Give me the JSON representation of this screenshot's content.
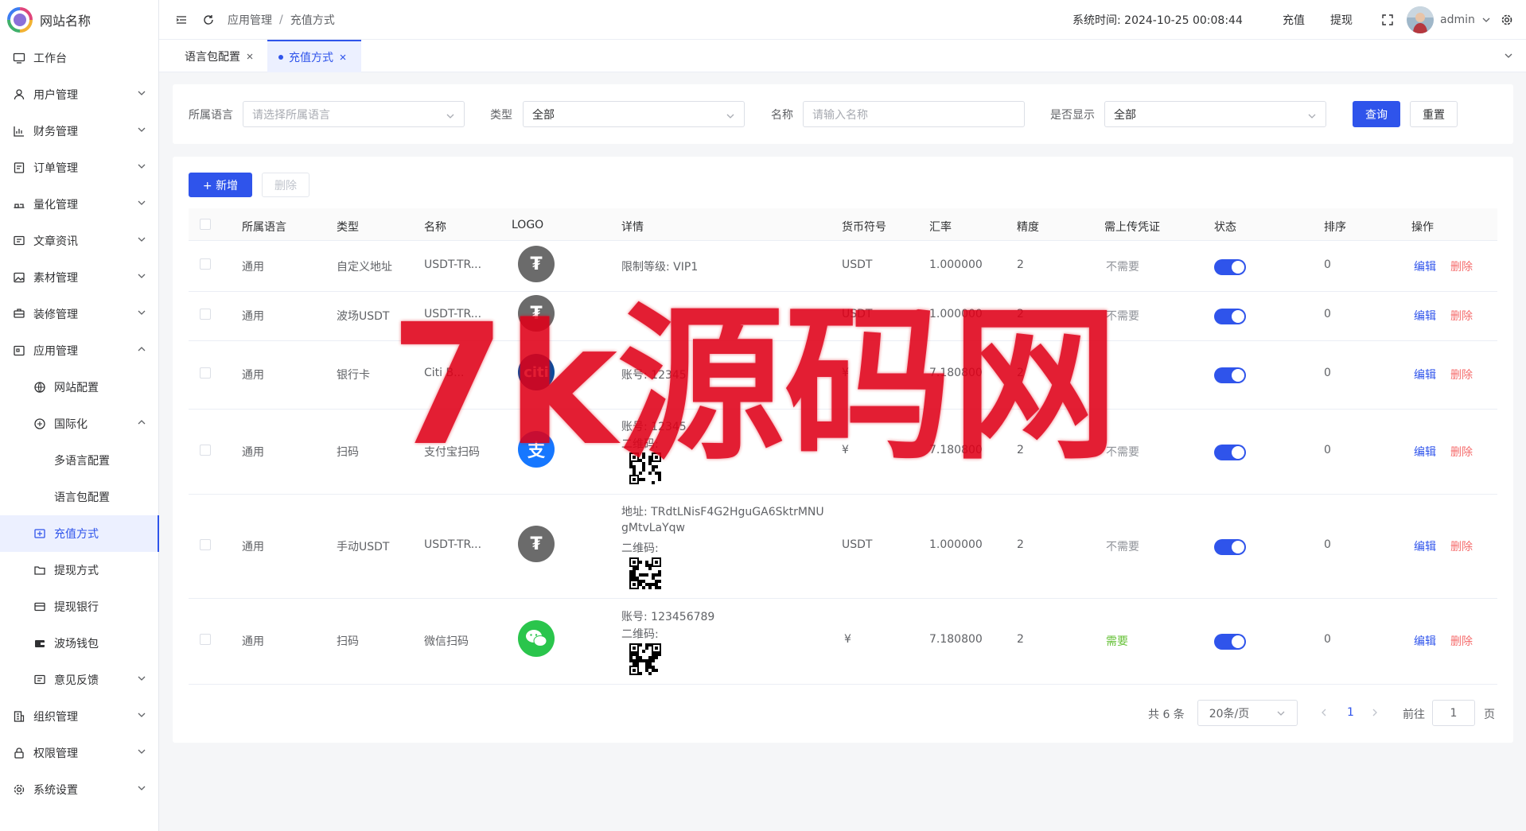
{
  "brand": {
    "site_name": "网站名称"
  },
  "sidebar": {
    "items": [
      {
        "label": "工作台",
        "icon": "monitor-icon"
      },
      {
        "label": "用户管理",
        "icon": "user-icon"
      },
      {
        "label": "财务管理",
        "icon": "chart-icon"
      },
      {
        "label": "订单管理",
        "icon": "order-icon"
      },
      {
        "label": "量化管理",
        "icon": "quant-icon"
      },
      {
        "label": "文章资讯",
        "icon": "article-icon"
      },
      {
        "label": "素材管理",
        "icon": "image-icon"
      },
      {
        "label": "装修管理",
        "icon": "decor-icon"
      },
      {
        "label": "应用管理",
        "icon": "app-icon"
      },
      {
        "label": "网站配置",
        "icon": "globe-icon"
      },
      {
        "label": "国际化",
        "icon": "intl-icon"
      },
      {
        "label": "多语言配置",
        "icon": ""
      },
      {
        "label": "语言包配置",
        "icon": ""
      },
      {
        "label": "充值方式",
        "icon": "recharge-icon"
      },
      {
        "label": "提现方式",
        "icon": "folder-icon"
      },
      {
        "label": "提现银行",
        "icon": "card-icon"
      },
      {
        "label": "波场钱包",
        "icon": "wallet-icon"
      },
      {
        "label": "意见反馈",
        "icon": "feedback-icon"
      },
      {
        "label": "组织管理",
        "icon": "org-icon"
      },
      {
        "label": "权限管理",
        "icon": "lock-icon"
      },
      {
        "label": "系统设置",
        "icon": "gear-icon"
      }
    ]
  },
  "header": {
    "breadcrumb": [
      "应用管理",
      "充值方式"
    ],
    "system_time": "系统时间: 2024-10-25 00:08:44",
    "recharge": "充值",
    "withdraw": "提现",
    "user": "admin"
  },
  "tabs": [
    {
      "label": "语言包配置"
    },
    {
      "label": "充值方式"
    }
  ],
  "search": {
    "lang_label": "所属语言",
    "lang_placeholder": "请选择所属语言",
    "type_label": "类型",
    "type_value": "全部",
    "name_label": "名称",
    "name_placeholder": "请输入名称",
    "show_label": "是否显示",
    "show_value": "全部",
    "query": "查询",
    "reset": "重置"
  },
  "toolbar": {
    "add": "+ 新增",
    "delete": "删除"
  },
  "table": {
    "columns": [
      "所属语言",
      "类型",
      "名称",
      "LOGO",
      "详情",
      "货币符号",
      "汇率",
      "精度",
      "需上传凭证",
      "状态",
      "排序",
      "操作"
    ],
    "rows": [
      {
        "lang": "通用",
        "type": "自定义地址",
        "name": "USDT-TR...",
        "logo": "tether-icon",
        "detail": [
          "限制等级: VIP1"
        ],
        "currency": "USDT",
        "rate": "1.000000",
        "precision": "2",
        "voucher": "不需要",
        "sort": "0"
      },
      {
        "lang": "通用",
        "type": "波场USDT",
        "name": "USDT-TR...",
        "logo": "tether-icon",
        "detail": [],
        "currency": "USDT",
        "rate": "1.000000",
        "precision": "2",
        "voucher": "不需要",
        "sort": "0"
      },
      {
        "lang": "通用",
        "type": "银行卡",
        "name": "Citi B...",
        "logo": "citi-icon",
        "detail": [
          "账号: 12345",
          "",
          ""
        ],
        "currency": "¥",
        "rate": "7.180800",
        "precision": "2",
        "voucher": "",
        "sort": "0"
      },
      {
        "lang": "通用",
        "type": "扫码",
        "name": "支付宝扫码",
        "logo": "alipay-icon",
        "detail": [
          "账号: 12345",
          "二维码:"
        ],
        "currency": "¥",
        "rate": "7.180800",
        "precision": "2",
        "voucher": "不需要",
        "sort": "0"
      },
      {
        "lang": "通用",
        "type": "手动USDT",
        "name": "USDT-TR...",
        "logo": "tether-icon",
        "detail": [
          "地址: TRdtLNisF4G2HguGA6SktrMNU",
          "gMtvLaYqw",
          "二维码:"
        ],
        "currency": "USDT",
        "rate": "1.000000",
        "precision": "2",
        "voucher": "不需要",
        "sort": "0"
      },
      {
        "lang": "通用",
        "type": "扫码",
        "name": "微信扫码",
        "logo": "wechat-icon",
        "detail": [
          "账号: 123456789",
          "二维码:"
        ],
        "currency": "¥",
        "rate": "7.180800",
        "precision": "2",
        "voucher": "需要",
        "sort": "0"
      }
    ],
    "edit": "编辑",
    "delete": "删除"
  },
  "pagination": {
    "total": "共 6 条",
    "page_size": "20条/页",
    "current": "1",
    "goto": "前往",
    "goto_value": "1",
    "page_unit": "页"
  },
  "watermark": {
    "text": "7k源码网"
  },
  "colors": {
    "primary": "#2f54eb",
    "danger": "#f56c6c",
    "success": "#67c23a",
    "watermark": "#e00018"
  }
}
